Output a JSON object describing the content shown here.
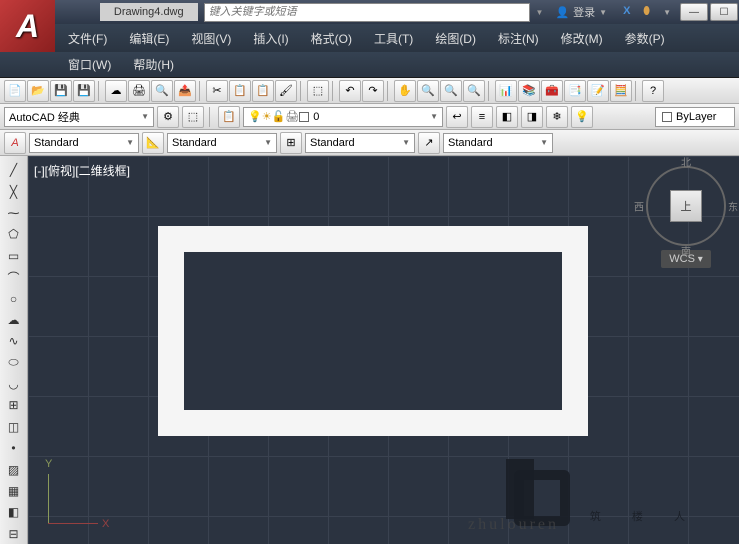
{
  "titlebar": {
    "document": "Drawing4.dwg",
    "search_placeholder": "键入关键字或短语",
    "login": "登录"
  },
  "menu": {
    "file": "文件(F)",
    "edit": "编辑(E)",
    "view": "视图(V)",
    "insert": "插入(I)",
    "format": "格式(O)",
    "tools": "工具(T)",
    "draw": "绘图(D)",
    "dimension": "标注(N)",
    "modify": "修改(M)",
    "parametric": "参数(P)",
    "window": "窗口(W)",
    "help": "帮助(H)"
  },
  "workspace": {
    "selected": "AutoCAD 经典"
  },
  "layer": {
    "current": "0",
    "bylayer": "ByLayer"
  },
  "style": {
    "standard1": "Standard",
    "standard2": "Standard",
    "standard3": "Standard",
    "standard4": "Standard"
  },
  "viewport": {
    "label": "[-][俯视][二维线框]",
    "wcs": "WCS",
    "axis_y": "Y",
    "axis_x": "X"
  },
  "viewcube": {
    "north": "北",
    "south": "南",
    "east": "东",
    "west": "西",
    "top": "上"
  },
  "watermark": {
    "text": "筑 楼 人",
    "url": "zhulouren"
  }
}
